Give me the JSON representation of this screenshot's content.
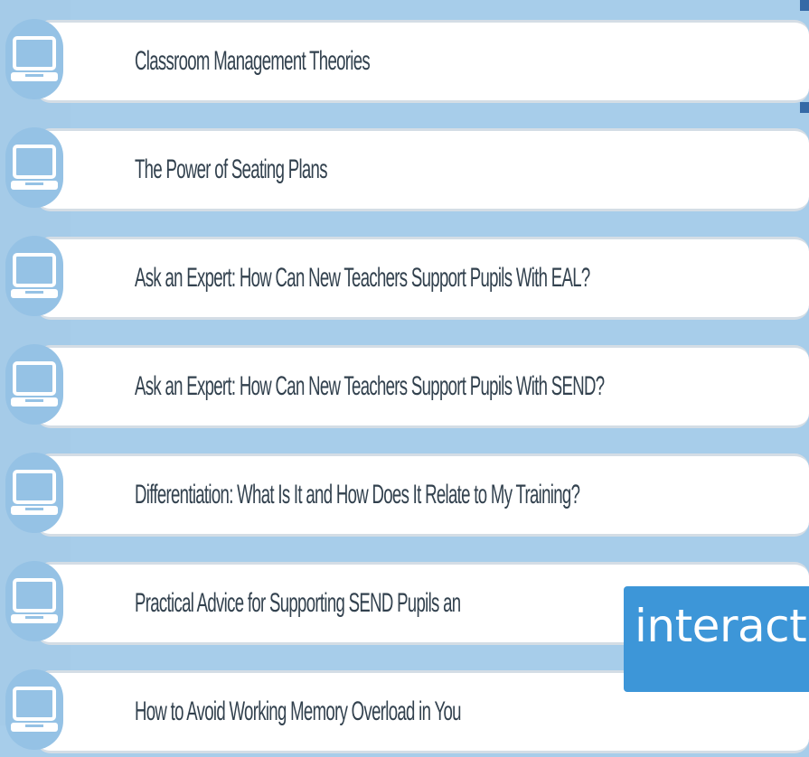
{
  "course": {
    "items": [
      {
        "title": "Classroom Management Theories",
        "icon": "laptop-icon"
      },
      {
        "title": "The Power of Seating Plans",
        "icon": "laptop-icon"
      },
      {
        "title": "Ask an Expert: How Can New Teachers Support Pupils With EAL?",
        "icon": "laptop-icon"
      },
      {
        "title": "Ask an Expert: How Can New Teachers Support Pupils With SEND?",
        "icon": "laptop-icon"
      },
      {
        "title": "Differentiation: What Is It and How Does It Relate to My Training?",
        "icon": "laptop-icon"
      },
      {
        "title": "Practical Advice for Supporting SEND Pupils an",
        "icon": "laptop-icon"
      },
      {
        "title": "How to Avoid Working Memory Overload in You",
        "icon": "laptop-icon"
      }
    ]
  },
  "overlay": {
    "label": "interactiv"
  },
  "colors": {
    "rail": "#a5cbe8",
    "icon_circle": "#95c2e5",
    "overlay": "#3d96d8",
    "text": "#32414e"
  }
}
